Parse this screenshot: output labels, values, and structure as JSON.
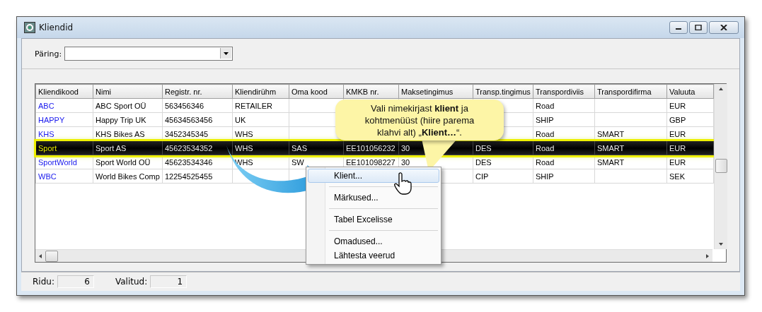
{
  "window": {
    "title": "Kliendid"
  },
  "query": {
    "label": "Päring:"
  },
  "table": {
    "columns": [
      "Kliendikood",
      "Nimi",
      "Registr. nr.",
      "Kliendirühm",
      "Oma kood",
      "KMKB nr.",
      "Maksetingimus",
      "Transp.tingimus",
      "Transpordiviis",
      "Transpordifirma",
      "Valuuta"
    ],
    "rows": [
      {
        "selected": false,
        "cells": [
          "ABC",
          "ABC Sport OÜ",
          "563456346",
          "RETAILER",
          null,
          null,
          null,
          null,
          "Road",
          null,
          "EUR"
        ]
      },
      {
        "selected": false,
        "cells": [
          "HAPPY",
          "Happy Trip UK",
          "45634563456",
          "UK",
          null,
          null,
          null,
          null,
          "SHIP",
          null,
          "GBP"
        ]
      },
      {
        "selected": false,
        "cells": [
          "KHS",
          "KHS Bikes AS",
          "3452345345",
          "WHS",
          null,
          null,
          null,
          null,
          "Road",
          "SMART",
          "EUR"
        ]
      },
      {
        "selected": true,
        "cells": [
          "Sport",
          "Sport AS",
          "45623534352",
          "WHS",
          "SAS",
          "EE101056232",
          "30",
          "DES",
          "Road",
          "SMART",
          "EUR"
        ]
      },
      {
        "selected": false,
        "cells": [
          "SportWorld",
          "Sport World OÜ",
          "45623534346",
          "WHS",
          "SW",
          "EE101098227",
          "30",
          "DES",
          "Road",
          "SMART",
          "EUR"
        ]
      },
      {
        "selected": false,
        "cells": [
          "WBC",
          "World Bikes Comp",
          "12254525455",
          null,
          null,
          null,
          null,
          "CIP",
          "SHIP",
          null,
          "SEK"
        ]
      }
    ]
  },
  "context_menu": {
    "groups": [
      [
        {
          "label": "Klient...",
          "selected": true
        }
      ],
      [
        {
          "label": "Märkused...",
          "selected": false
        }
      ],
      [
        {
          "label": "Tabel Excelisse",
          "selected": false
        }
      ],
      [
        {
          "label": "Omadused...",
          "selected": false
        },
        {
          "label": "Lähtesta veerud",
          "selected": false
        }
      ]
    ]
  },
  "callout": {
    "text": "Vali nimekirjast **klient** ja kohtmenüüst (hiire parema klahvi alt) „**Klient…**“."
  },
  "status_bar": [
    {
      "label": "Ridu:",
      "value": "6"
    },
    {
      "label": "Valitud:",
      "value": "1"
    }
  ]
}
